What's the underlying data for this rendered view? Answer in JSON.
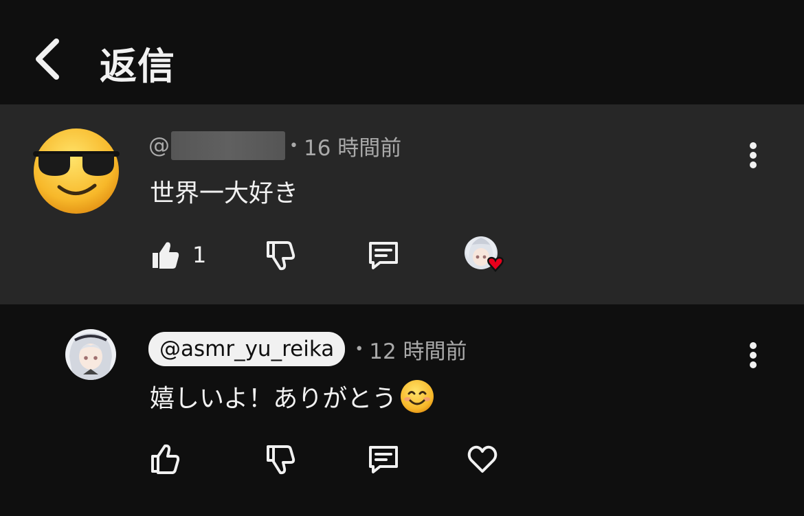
{
  "header": {
    "title": "返信"
  },
  "comment": {
    "handle_prefix": "@",
    "time": "16 時間前",
    "text": "世界一大好き",
    "like_count": "1"
  },
  "reply": {
    "handle": "@asmr_yu_reika",
    "time": "12 時間前",
    "text": "嬉しいよ！ありがとう"
  },
  "colors": {
    "background": "#0f0f0f",
    "highlight": "#272727",
    "heart": "#e8001c"
  }
}
